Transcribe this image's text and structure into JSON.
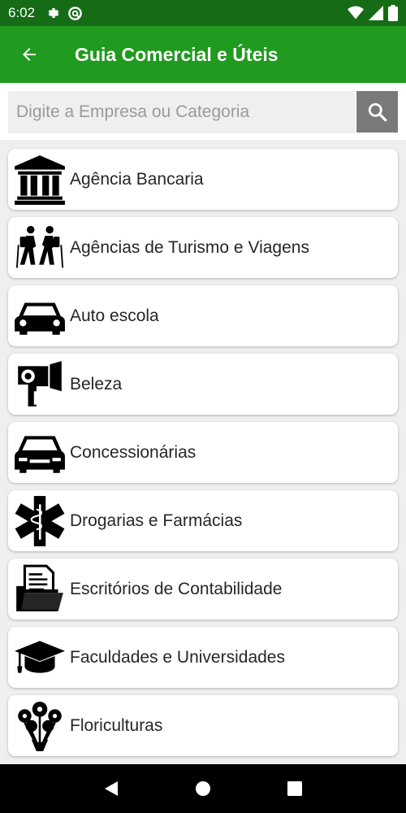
{
  "status_bar": {
    "time": "6:02",
    "left_icons": [
      "gear-icon",
      "at-sign-icon"
    ],
    "right_icons": [
      "wifi-icon",
      "signal-icon",
      "battery-icon"
    ]
  },
  "app_bar": {
    "back_icon": "arrow-left-icon",
    "title": "Guia Comercial e Úteis",
    "color": "#209a1f",
    "status_color": "#166b16"
  },
  "search": {
    "placeholder": "Digite a Empresa ou Categoria",
    "value": "",
    "button_icon": "search-icon"
  },
  "categories": [
    {
      "label": "Agência Bancaria",
      "icon": "bank-icon"
    },
    {
      "label": "Agências de Turismo e Viagens",
      "icon": "hikers-icon"
    },
    {
      "label": "Auto escola",
      "icon": "car-icon"
    },
    {
      "label": "Beleza",
      "icon": "hair-dryer-icon"
    },
    {
      "label": "Concessionárias",
      "icon": "car-front-icon"
    },
    {
      "label": "Drogarias e Farmácias",
      "icon": "star-of-life-icon"
    },
    {
      "label": "Escritórios de Contabilidade",
      "icon": "folder-documents-icon"
    },
    {
      "label": "Faculdades e Universidades",
      "icon": "graduation-cap-icon"
    },
    {
      "label": "Floriculturas",
      "icon": "flowers-icon"
    }
  ],
  "nav_bar": {
    "buttons": [
      "back-triangle-icon",
      "home-circle-icon",
      "recents-square-icon"
    ]
  }
}
